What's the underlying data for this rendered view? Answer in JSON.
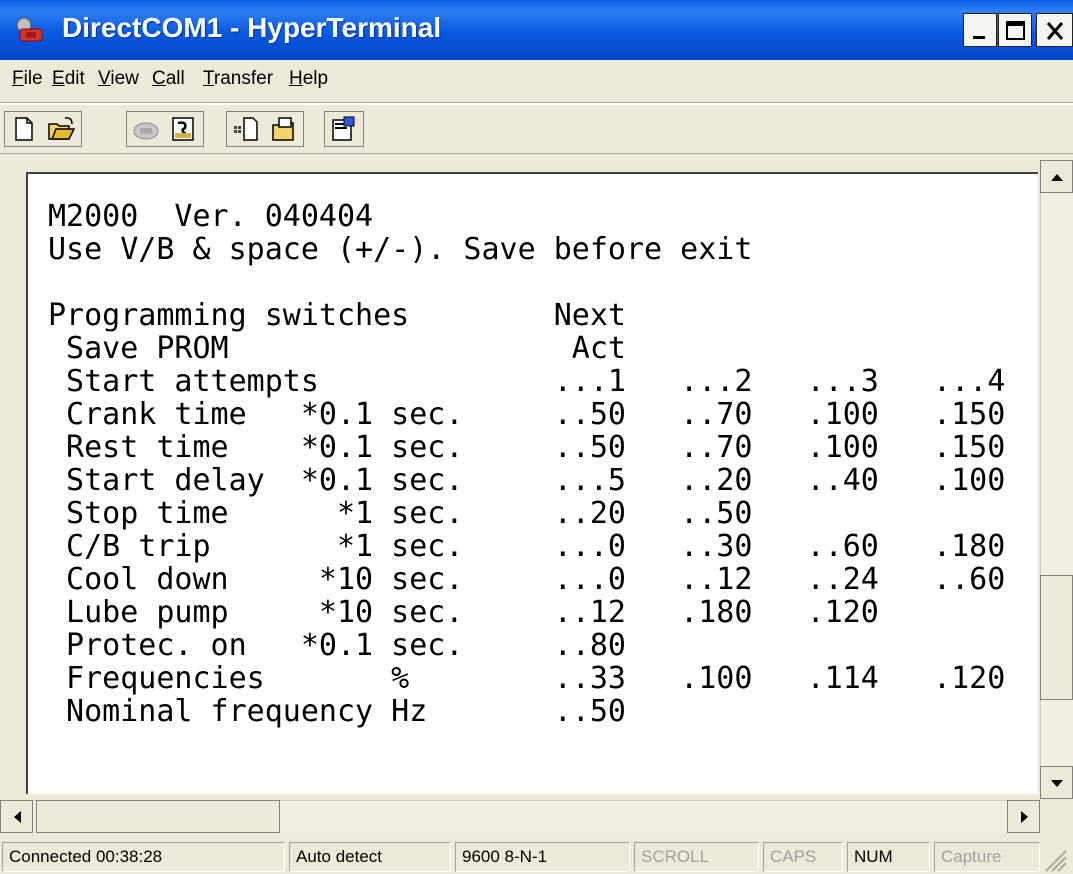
{
  "window": {
    "title": "DirectCOM1 - HyperTerminal",
    "icon": "hyperterminal-phone-icon",
    "controls": [
      "minimize-icon",
      "maximize-icon",
      "close-icon"
    ]
  },
  "menu": {
    "items": [
      {
        "label": "File"
      },
      {
        "label": "Edit"
      },
      {
        "label": "View"
      },
      {
        "label": "Call"
      },
      {
        "label": "Transfer"
      },
      {
        "label": "Help"
      }
    ]
  },
  "toolbar": {
    "buttons": [
      "new-connection-icon",
      "open-icon",
      "call-icon",
      "disconnect-icon",
      "send-icon",
      "receive-icon",
      "properties-icon"
    ]
  },
  "terminal": {
    "lines": [
      "M2000  Ver. 040404",
      "Use V/B & space (+/-). Save before exit",
      "",
      "Programming switches        Next",
      " Save PROM                   Act",
      " Start attempts             ...1   ...2   ...3   ...4",
      " Crank time   *0.1 sec.     ..50   ..70   .100   .150",
      " Rest time    *0.1 sec.     ..50   ..70   .100   .150",
      " Start delay  *0.1 sec.     ...5   ..20   ..40   .100",
      " Stop time      *1 sec.     ..20   ..50",
      " C/B trip       *1 sec.     ...0   ..30   ..60   .180",
      " Cool down     *10 sec.     ...0   ..12   ..24   ..60",
      " Lube pump     *10 sec.     ..12   .180   .120",
      " Protec. on   *0.1 sec.     ..80",
      " Frequencies       %        ..33   .100   .114   .120",
      " Nominal frequency Hz       ..50"
    ]
  },
  "status": {
    "connected": "Connected 00:38:28",
    "detect": "Auto detect",
    "settings": "9600 8-N-1",
    "scroll": "SCROLL",
    "caps": "CAPS",
    "num": "NUM",
    "capture": "Capture"
  }
}
